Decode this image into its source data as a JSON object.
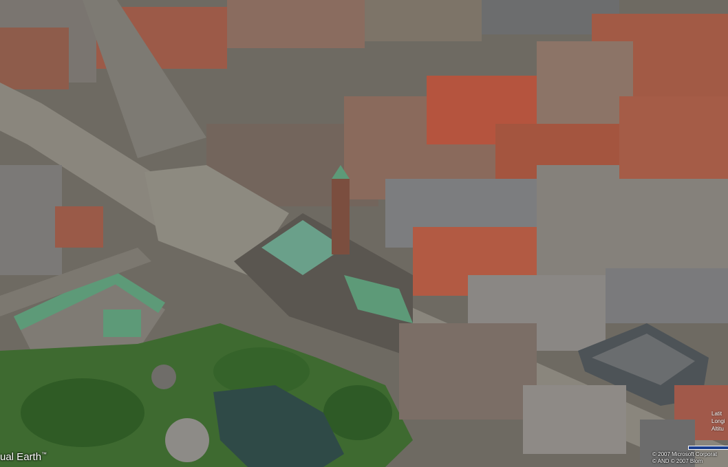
{
  "map": {
    "view": "aerial bird's-eye",
    "colors": {
      "roof_red": "#b5543e",
      "roof_grey": "#7d7f82",
      "roof_green": "#5d9a78",
      "tree": "#3a6a2c",
      "lake": "#2f4a47",
      "road": "#7a7670",
      "plaza": "#8d8a80"
    }
  },
  "overlay": {
    "brand_text": "ual Earth",
    "brand_mark": "™",
    "coords": [
      "Latit",
      "Longi",
      "Altitu"
    ],
    "copyright": [
      "© 2007 Microsoft Corporat",
      "© AND  © 2007 Blom"
    ],
    "scale_bar_color": "#1b3f8f"
  }
}
